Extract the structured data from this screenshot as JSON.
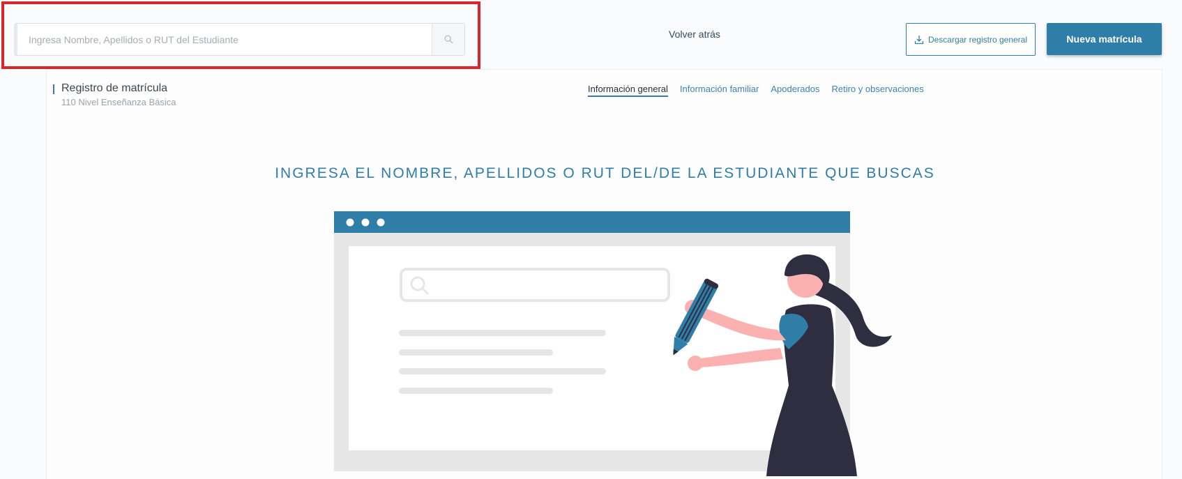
{
  "search": {
    "placeholder": "Ingresa Nombre, Apellidos o RUT del Estudiante",
    "button_icon": "search-icon"
  },
  "header": {
    "back_label": "Volver atrás",
    "download_label": "Descargar registro general",
    "download_icon": "download-icon",
    "new_label": "Nueva matrícula"
  },
  "card": {
    "title": "Registro de matrícula",
    "subtitle": "110 Nivel Enseñanza Básica",
    "tabs": [
      {
        "label": "Información general"
      },
      {
        "label": "Información familiar"
      },
      {
        "label": "Apoderados"
      },
      {
        "label": "Retiro y observaciones"
      }
    ],
    "heading": "INGRESA EL NOMBRE, APELLIDOS O RUT DEL/DE LA ESTUDIANTE QUE BUSCAS"
  },
  "colors": {
    "accent": "#2f7ea8",
    "highlight": "#d9262a",
    "figure_dark": "#2f2e41",
    "skin": "#fcb1b1"
  }
}
